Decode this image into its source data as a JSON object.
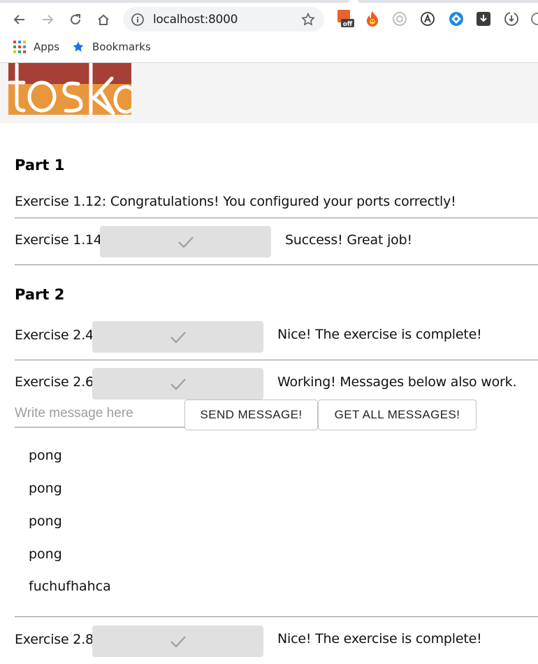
{
  "browser": {
    "url": "localhost:8000",
    "bookmarks": [
      {
        "label": "Apps",
        "icon": "apps-grid-icon"
      },
      {
        "label": "Bookmarks",
        "icon": "star-icon"
      }
    ],
    "extensions": [
      "pdf-off-icon",
      "fire-extension-icon",
      "circle-extension-icon",
      "a-circle-extension-icon",
      "blue-diamond-extension-icon",
      "download-box-icon",
      "clock-download-icon"
    ],
    "extension_badge": "off"
  },
  "logo": {
    "text": "toska",
    "colors": {
      "top": "#a63f35",
      "bottom": "#e8973d"
    }
  },
  "part1": {
    "title": "Part 1",
    "ex112": "Exercise 1.12: Congratulations! You configured your ports correctly!",
    "ex114": {
      "label": "Exercise 1.14:",
      "status": "Success! Great job!"
    }
  },
  "part2": {
    "title": "Part 2",
    "ex24": {
      "label": "Exercise 2.4:",
      "status": "Nice! The exercise is complete!"
    },
    "ex26": {
      "label": "Exercise 2.6:",
      "status": "Working! Messages below also work."
    },
    "message_input": {
      "placeholder": "Write message here",
      "value": ""
    },
    "send_label": "SEND MESSAGE!",
    "get_all_label": "GET ALL MESSAGES!",
    "messages": [
      "pong",
      "pong",
      "pong",
      "pong",
      "fuchufhahca"
    ],
    "ex28": {
      "label": "Exercise 2.8:",
      "status": "Nice! The exercise is complete!"
    }
  },
  "colors": {
    "button_bg": "#e0e0e0",
    "check": "#9e9e9e",
    "divider": "#8c8c8c"
  }
}
